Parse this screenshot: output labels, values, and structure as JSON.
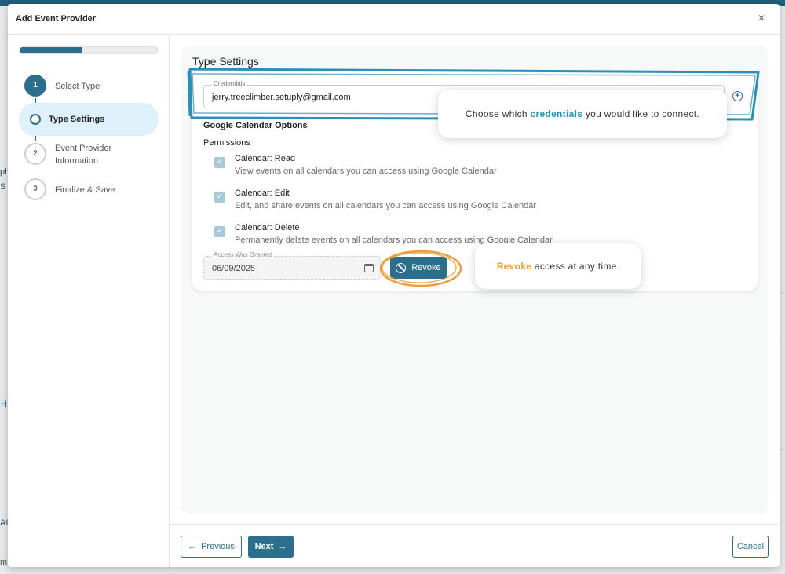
{
  "background": {
    "fragments": [
      "ph",
      "S",
      "H",
      "AI",
      "m"
    ]
  },
  "modal": {
    "title": "Add Event Provider",
    "close_label": "×"
  },
  "stepper": {
    "progress": 0.45,
    "steps": [
      {
        "number": "1",
        "label": "Select Type",
        "state": "done"
      },
      {
        "number": "",
        "label": "Type Settings",
        "state": "active"
      },
      {
        "number": "2",
        "label": "Event Provider Information",
        "state": "pending"
      },
      {
        "number": "3",
        "label": "Finalize & Save",
        "state": "pending"
      }
    ]
  },
  "settings": {
    "section_title": "Type Settings",
    "credentials": {
      "legend": "Credentials",
      "value": "jerry.treeclimber.setuply@gmail.com"
    },
    "add_icon": "⊕",
    "options_title": "Google Calendar Options",
    "permissions_label": "Permissions",
    "permissions": [
      {
        "title": "Calendar: Read",
        "desc": "View events on all calendars you can access using Google Calendar",
        "checked": true
      },
      {
        "title": "Calendar: Edit",
        "desc": "Edit, and share events on all calendars you can access using Google Calendar",
        "checked": true
      },
      {
        "title": "Calendar: Delete",
        "desc": "Permanently delete events on all calendars you can access using Google Calendar",
        "checked": true
      }
    ],
    "access": {
      "legend": "Access Was Granted",
      "value": "06/09/2025"
    },
    "revoke_label": "Revoke"
  },
  "footer": {
    "previous_label": "Previous",
    "next_label": "Next",
    "cancel_label": "Cancel"
  },
  "annotations": {
    "credentials_tip": {
      "pre": "Choose which ",
      "highlight": "credentials",
      "post": " you would like to connect."
    },
    "revoke_tip": {
      "highlight": "Revoke",
      "post": " access at any time."
    },
    "colors": {
      "blue": "#2b8fb8",
      "orange": "#e8a038",
      "primary": "#2b6f8c"
    }
  }
}
